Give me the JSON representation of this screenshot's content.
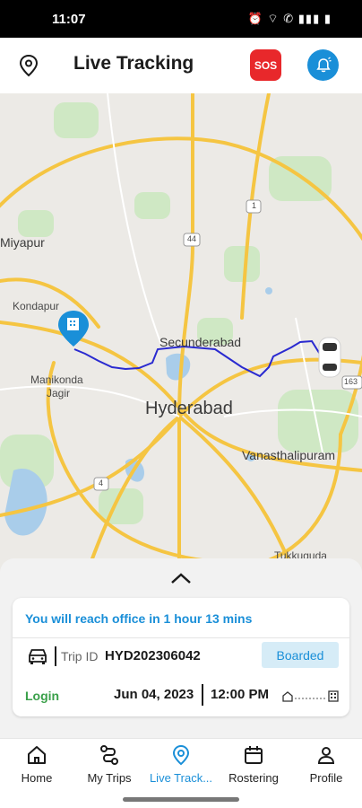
{
  "status_bar": {
    "time": "11:07",
    "icons": "⏰ ⌔ ✆ ▮▮▮ ▮"
  },
  "header": {
    "title": "Live Tracking",
    "sos_label": "SOS",
    "location_icon": "location-pin-icon",
    "bell_icon": "bell-icon"
  },
  "map": {
    "labels": {
      "miyapur": "Miyapur",
      "kondapur": "Kondapur",
      "manikonda": "Manikonda",
      "jagir": "Jagir",
      "secunderabad": "Secunderabad",
      "hyderabad": "Hyderabad",
      "vanasthalipuram": "Vanasthalipuram",
      "tukkuguda": "Tukkuguda",
      "shield_44": "44",
      "shield_1": "1",
      "shield_163": "163",
      "shield_4": "4"
    }
  },
  "trip": {
    "eta": "You will reach office in 1 hour 13 mins",
    "trip_id_label": "Trip ID",
    "trip_id": "HYD202306042",
    "status": "Boarded",
    "type": "Login",
    "date": "Jun 04, 2023",
    "time": "12:00 PM"
  },
  "nav": [
    {
      "label": "Home",
      "icon": "home-icon"
    },
    {
      "label": "My Trips",
      "icon": "route-icon"
    },
    {
      "label": "Live Track...",
      "icon": "location-pin-icon",
      "active": true
    },
    {
      "label": "Rostering",
      "icon": "calendar-icon"
    },
    {
      "label": "Profile",
      "icon": "user-icon"
    }
  ],
  "colors": {
    "accent": "#1a8fd8",
    "sos": "#e8282b",
    "login": "#3aa04a",
    "route": "#2a2ad0"
  }
}
